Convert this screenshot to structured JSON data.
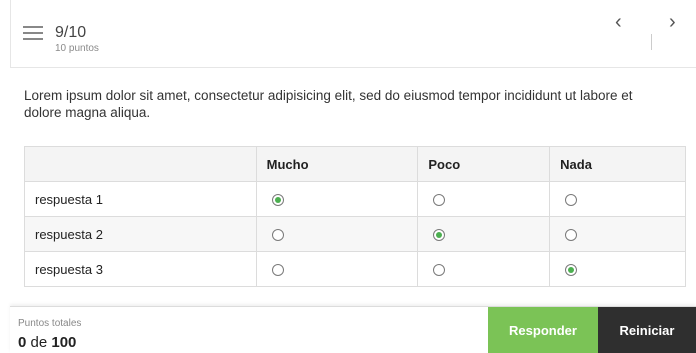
{
  "header": {
    "counter": "9/10",
    "points_sub": "10 puntos",
    "prev_glyph": "‹",
    "next_glyph": "›"
  },
  "question": {
    "text": "Lorem ipsum dolor sit amet, consectetur adipisicing elit, sed do eiusmod tempor incididunt ut labore et dolore magna aliqua."
  },
  "grid": {
    "columns": [
      "",
      "Mucho",
      "Poco",
      "Nada"
    ],
    "rows": [
      {
        "label": "respuesta 1",
        "selected": "Mucho"
      },
      {
        "label": "respuesta 2",
        "selected": "Poco"
      },
      {
        "label": "respuesta 3",
        "selected": "Nada"
      }
    ]
  },
  "footer": {
    "total_label": "Puntos totales",
    "score": "0",
    "score_of": "de",
    "score_max": "100",
    "responder_label": "Responder",
    "reiniciar_label": "Reiniciar"
  },
  "colors": {
    "accent": "#7bc356",
    "dark_button": "#2f2f2f",
    "radio_checked": "#4caf50"
  }
}
